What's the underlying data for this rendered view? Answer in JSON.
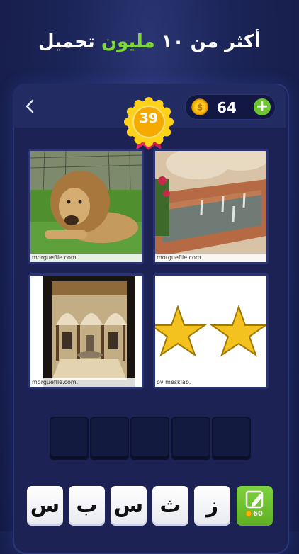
{
  "headline": {
    "prefix": "أكثر من ١٠",
    "accent": "مليون",
    "suffix": "تحميل"
  },
  "header": {
    "coins": "64",
    "add_label": "+",
    "level": "39"
  },
  "images": [
    {
      "subject": "lion",
      "credit": "morguefile.com."
    },
    {
      "subject": "fountain",
      "credit": "morguefile.com."
    },
    {
      "subject": "courtyard",
      "credit": "morguefile.com."
    },
    {
      "subject": "stars",
      "credit": "ov mesklab."
    }
  ],
  "answer_slots": 5,
  "letters": [
    "س",
    "ب",
    "س",
    "ث",
    "ز"
  ],
  "hint": {
    "price": "60",
    "icon": "pencil-icon"
  },
  "colors": {
    "accent_green": "#7fd63a",
    "badge_gold": "#f5b800"
  }
}
